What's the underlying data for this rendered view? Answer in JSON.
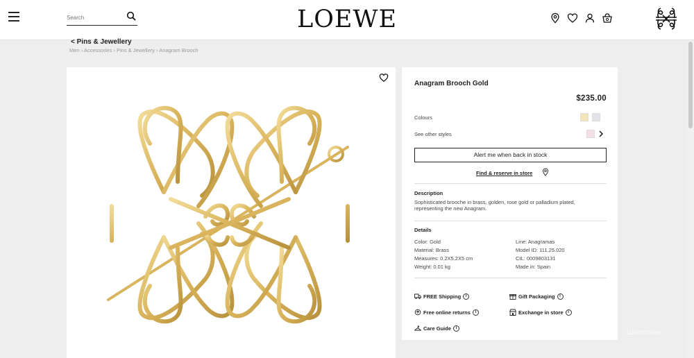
{
  "header": {
    "search_placeholder": "Search",
    "logo": "LOEWE"
  },
  "breadcrumb": {
    "back_label": "< Pins & Jewellery",
    "items": [
      "Men",
      "Accessories",
      "Pins & Jewellery",
      "Anagram Brooch"
    ],
    "separator": "›"
  },
  "product": {
    "name": "Anagram Brooch Gold",
    "price": "$235.00",
    "colours_label": "Colours",
    "other_styles_label": "See other styles",
    "alert_button": "Alert me when back in stock",
    "find_label": "Find & reserve in store",
    "description_title": "Description",
    "description": "Sophisticated brooche in brass, golden, rose gold or palladium plated, representing the new Anagram.",
    "details_title": "Details",
    "details": [
      "Color: Gold",
      "Line: Anagramas",
      "Material: Brass",
      "Model ID: 111.25.020",
      "Measures: 0.2X5.2X5 cm",
      "CIL: 0009803131",
      "Weight: 0.01 kg",
      "Made in: Spain"
    ],
    "services": {
      "shipping": "FREE Shipping",
      "gift": "Gift Packaging",
      "returns": "Free online returns",
      "exchange": "Exchange in store",
      "care": "Care Guide"
    }
  },
  "colors": {
    "gold": "#e2bf6a",
    "gold_dark": "#b8913c",
    "swatch_gold": "#f2e6b8",
    "swatch_silver": "#e2e4ea",
    "swatch_rose": "#f3dfe3"
  },
  "watermark": "Шопоголик"
}
